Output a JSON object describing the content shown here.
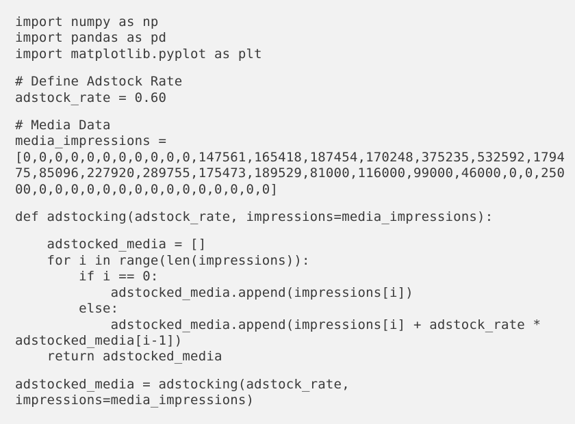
{
  "code": {
    "imports": [
      "import numpy as np",
      "import pandas as pd",
      "import matplotlib.pyplot as plt"
    ],
    "adstock": [
      "# Define Adstock Rate",
      "adstock_rate = 0.60"
    ],
    "media": [
      "# Media Data",
      "media_impressions =",
      "[0,0,0,0,0,0,0,0,0,0,0,147561,165418,187454,170248,375235,532592,1794",
      "75,85096,227920,289755,175473,189529,81000,116000,99000,46000,0,0,250",
      "00,0,0,0,0,0,0,0,0,0,0,0,0,0,0,0]"
    ],
    "def_line": "def adstocking(adstock_rate, impressions=media_impressions):",
    "body": [
      "    adstocked_media = []",
      "    for i in range(len(impressions)):",
      "        if i == 0:",
      "            adstocked_media.append(impressions[i])",
      "        else:",
      "            adstocked_media.append(impressions[i] + adstock_rate *",
      "adstocked_media[i-1])",
      "    return adstocked_media"
    ],
    "call": [
      "adstocked_media = adstocking(adstock_rate,",
      "impressions=media_impressions)"
    ]
  }
}
